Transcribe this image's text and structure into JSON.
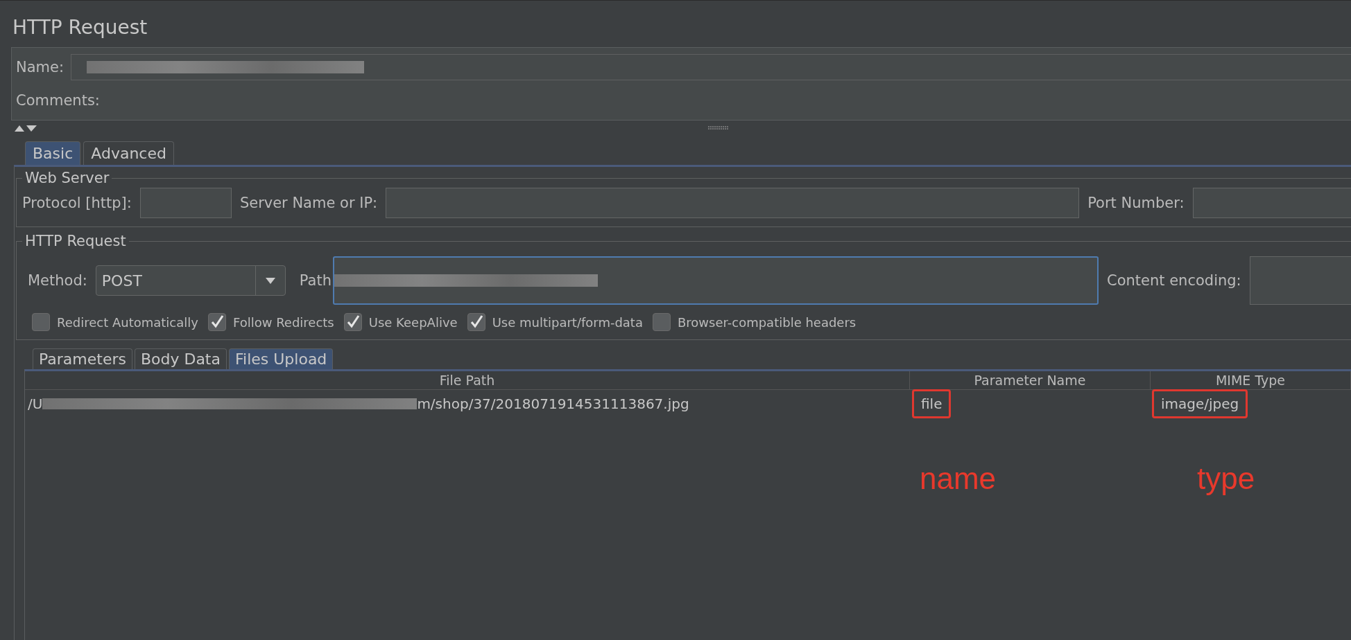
{
  "window": {
    "title": "HTTP Request"
  },
  "name_field": {
    "label": "Name:"
  },
  "comments": {
    "label": "Comments:"
  },
  "tabs": [
    {
      "label": "Basic",
      "selected": true
    },
    {
      "label": "Advanced",
      "selected": false
    }
  ],
  "web_server": {
    "title": "Web Server",
    "protocol_label": "Protocol [http]:",
    "server_label": "Server Name or IP:",
    "port_label": "Port Number:"
  },
  "http_request": {
    "title": "HTTP Request",
    "method_label": "Method:",
    "method_value": "POST",
    "path_label": "Path",
    "encoding_label": "Content encoding:",
    "options": [
      {
        "label": "Redirect Automatically",
        "checked": false
      },
      {
        "label": "Follow Redirects",
        "checked": true
      },
      {
        "label": "Use KeepAlive",
        "checked": true
      },
      {
        "label": "Use multipart/form-data",
        "checked": true
      },
      {
        "label": "Browser-compatible headers",
        "checked": false
      }
    ]
  },
  "sub_tabs": [
    {
      "label": "Parameters",
      "selected": false
    },
    {
      "label": "Body Data",
      "selected": false
    },
    {
      "label": "Files Upload",
      "selected": true
    }
  ],
  "table": {
    "columns": [
      "File Path",
      "Parameter Name",
      "MIME Type"
    ],
    "rows": [
      {
        "path_start": "/U",
        "path_end": "m/shop/37/2018071914531113867.jpg",
        "parameter": "file",
        "mime": "image/jpeg"
      }
    ]
  },
  "annotations": [
    {
      "text": "name"
    },
    {
      "text": "type"
    }
  ]
}
